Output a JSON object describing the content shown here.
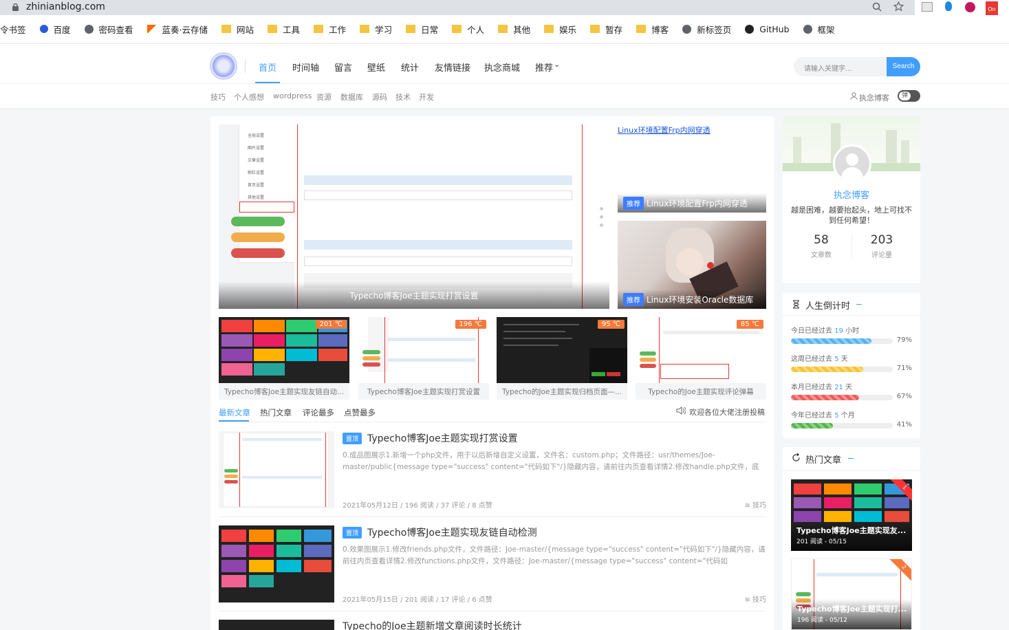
{
  "browser": {
    "url": "zhinianblog.com",
    "bookmarks": [
      "令书签",
      "百度",
      "密码查看",
      "蓝奏·云存储",
      "网站",
      "工具",
      "工作",
      "学习",
      "日常",
      "个人",
      "其他",
      "娱乐",
      "暂存",
      "博客",
      "新标签页",
      "GitHub",
      "框架"
    ]
  },
  "nav": {
    "items": [
      "首页",
      "时间轴",
      "留言",
      "壁纸",
      "统计",
      "友情链接",
      "执念商城",
      "推荐"
    ],
    "search_placeholder": "请输入关键字...",
    "search_button": "Search"
  },
  "subnav": {
    "items": [
      "技巧",
      "个人感想",
      "wordpress",
      "资源",
      "数据库",
      "源码",
      "技术",
      "开发"
    ],
    "user": "执念博客",
    "toggle": "弹"
  },
  "slider": {
    "main_caption": "Typecho博客Joe主题实现打赏设置",
    "right1_alt": "Linux环境配置Frp内网穿透",
    "right1_tag": "推荐",
    "right1_caption": "Linux环境配置Frp内网穿透",
    "right2_tag": "推荐",
    "right2_caption": "Linux环境安装Oracle数据库"
  },
  "thumbs": [
    {
      "title": "Typecho博客Joe主题实现友链自动...",
      "temp": "201 ℃"
    },
    {
      "title": "Typecho博客Joe主题实现打赏设置",
      "temp": "196 ℃"
    },
    {
      "title": "Typecho的Joe主题实现归档页面—...",
      "temp": "95 ℃"
    },
    {
      "title": "Typecho的Joe主题实现评论弹幕",
      "temp": "85 ℃"
    }
  ],
  "tabs": {
    "items": [
      "最新文章",
      "热门文章",
      "评论最多",
      "点赞最多"
    ],
    "notice": "欢迎各位大佬注册投稿"
  },
  "articles": [
    {
      "tag": "置顶",
      "title": "Typecho博客Joe主题实现打赏设置",
      "excerpt": "0.成品图展示1.新增一个php文件，用于以后新增自定义设置，文件名：custom.php；文件路径：usr/themes/Joe-master/public{message type=\"success\" content=\"代码如下\"/}隐藏内容，请前往内页查看详情2.修改handle.php文件，底部新增代码，...",
      "meta": "2021年05月12日 / 196 阅读 / 37 评论 / 8 点赞",
      "cat": "技巧"
    },
    {
      "tag": "置顶",
      "title": "Typecho博客Joe主题实现友链自动检测",
      "excerpt": "0.效果图展示1.修改friends.php文件，文件路径：Joe-master/{message type=\"success\" content=\"代码如下\"/}隐藏内容，请前往内页查看详情2.修改functions.php文件，文件路径：Joe-master/{message type=\"success\" content=\"代码如下\"/}$JFriend...",
      "meta": "2021年05月15日 / 201 阅读 / 17 评论 / 6 点赞",
      "cat": "技巧"
    },
    {
      "title": "Typecho的Joe主题新增文章阅读时长统计"
    }
  ],
  "profile": {
    "name": "执念博客",
    "motto": "越是困难，越要抬起头，地上可找不到任何希望！",
    "posts": "58",
    "posts_label": "文章数",
    "comments": "203",
    "comments_label": "评论量"
  },
  "countdown": {
    "title": "人生倒计时",
    "rows": [
      {
        "pre": "今日已经过去",
        "num": "19",
        "unit": "小时",
        "pct": "79%",
        "value": 0.79,
        "color": "#53b3f0"
      },
      {
        "pre": "这周已经过去",
        "num": "5",
        "unit": "天",
        "pct": "71%",
        "value": 0.71,
        "color": "#f8c331"
      },
      {
        "pre": "本月已经过去",
        "num": "21",
        "unit": "天",
        "pct": "67%",
        "value": 0.67,
        "color": "#f25a5a"
      },
      {
        "pre": "今年已经过去",
        "num": "5",
        "unit": "个月",
        "pct": "41%",
        "value": 0.41,
        "color": "#52b748"
      }
    ]
  },
  "hot": {
    "title": "热门文章",
    "items": [
      {
        "caption": "Typecho博客Joe主题实现友...",
        "sub": "201 阅读 - 05/15",
        "rank": "1"
      },
      {
        "caption": "Typecho博客Joe主题实现打...",
        "sub": "196 阅读 - 05/12",
        "rank": "2"
      }
    ]
  }
}
